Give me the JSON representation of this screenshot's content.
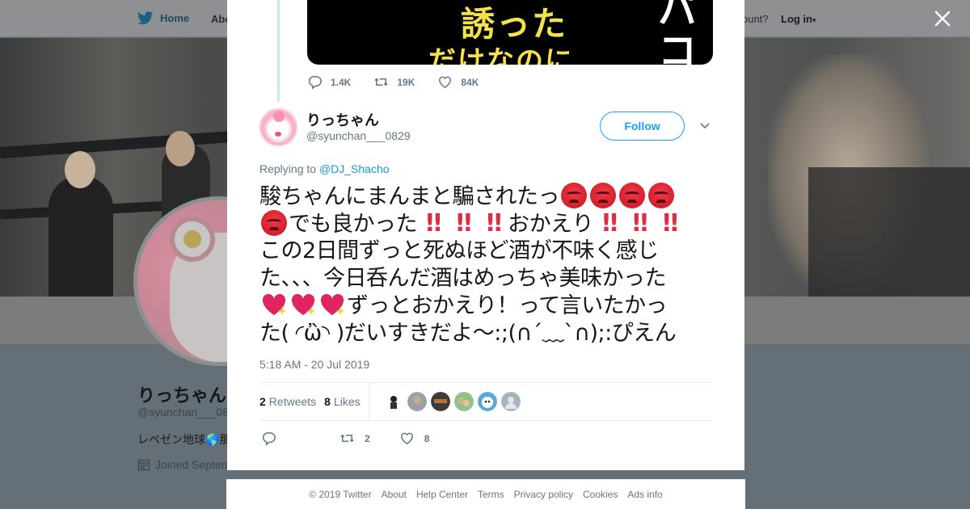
{
  "nav": {
    "home_label": "Home",
    "about_label": "Abo",
    "account_text": "ccount?",
    "login_label": "Log in"
  },
  "profile": {
    "name": "りっちゃん",
    "handle": "@syunchan___08",
    "bio": "レペゼン地球🌎那",
    "joined": "Joined Septem"
  },
  "prev_tweet": {
    "image_text": [
      "誘った",
      "だけなのに",
      "パコ"
    ],
    "replies": "1.4K",
    "retweets": "19K",
    "likes": "84K"
  },
  "tweet": {
    "author_name": "りっちゃん",
    "author_handle": "@syunchan___0829",
    "follow_label": "Follow",
    "replying_prefix": "Replying to ",
    "replying_to": "@DJ_Shacho",
    "lines": {
      "l1": "駿ちゃんにまんまと騙されたっ",
      "l2a": "でも良かった",
      "l2b": "おかえり",
      "l3": "この2日間ずっと死ぬほど酒が不味く感じ",
      "l4": "た、、、今日呑んだ酒はめっちゃ美味かった",
      "l5": "ずっとおかえり！って言いたかっ",
      "l6": "た( ◜ὢ◝ )だいすきだよ〜:;(∩´﹏`∩);:ぴえん"
    },
    "timestamp": "5:18 AM - 20 Jul 2019",
    "retweets_count": "2",
    "retweets_label": "Retweets",
    "likes_count": "8",
    "likes_label": "Likes",
    "action_retweets": "2",
    "action_likes": "8"
  },
  "footer": {
    "copyright": "© 2019 Twitter",
    "about": "About",
    "help": "Help Center",
    "terms": "Terms",
    "privacy": "Privacy policy",
    "cookies": "Cookies",
    "ads": "Ads info"
  },
  "colors": {
    "accent": "#1da1f2",
    "link": "#1b95e0",
    "muted": "#657786",
    "image_text_yellow": "#f4e24a"
  }
}
